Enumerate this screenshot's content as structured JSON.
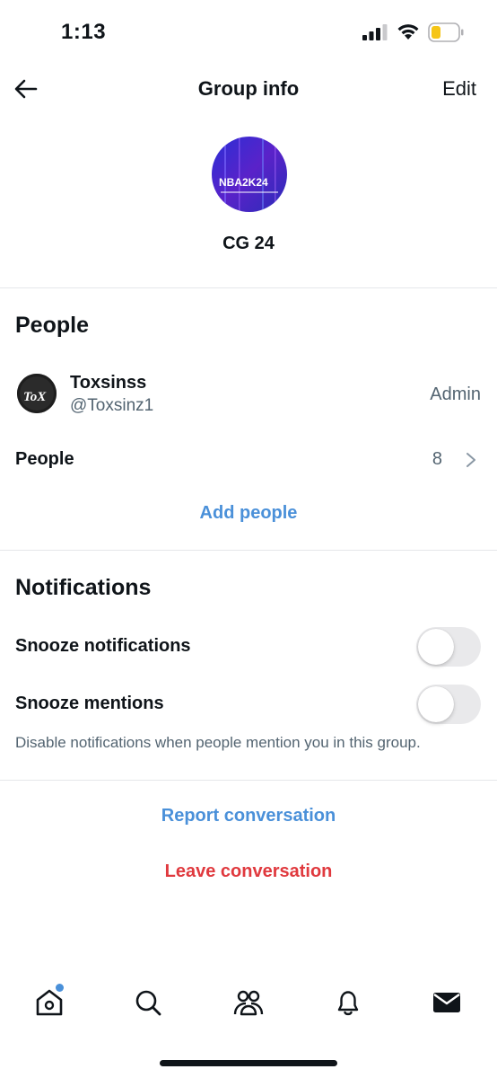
{
  "status_bar": {
    "time": "1:13",
    "signal_icon": "cellular-signal-icon",
    "wifi_icon": "wifi-icon",
    "battery_icon": "battery-low-icon",
    "battery_color": "#f5c518"
  },
  "header": {
    "back_icon": "arrow-left-icon",
    "title": "Group info",
    "edit_label": "Edit"
  },
  "group": {
    "name": "CG 24",
    "avatar_text": "NBA2K24"
  },
  "people_section": {
    "title": "People",
    "members": [
      {
        "name": "Toxsinss",
        "handle": "@Toxsinz1",
        "role": "Admin",
        "avatar_text": "ToX"
      }
    ],
    "people_label": "People",
    "people_count": "8",
    "add_people_label": "Add people"
  },
  "notifications_section": {
    "title": "Notifications",
    "snooze_notifications_label": "Snooze notifications",
    "snooze_notifications_on": false,
    "snooze_mentions_label": "Snooze mentions",
    "snooze_mentions_on": false,
    "helper_text": "Disable notifications when people mention you in this group."
  },
  "actions": {
    "report_label": "Report conversation",
    "leave_label": "Leave conversation",
    "link_color": "#4a90d9",
    "danger_color": "#e0393e"
  },
  "tab_bar": {
    "tabs": [
      "home-icon",
      "search-icon",
      "communities-icon",
      "notifications-bell-icon",
      "messages-envelope-icon"
    ],
    "home_has_badge": true
  }
}
